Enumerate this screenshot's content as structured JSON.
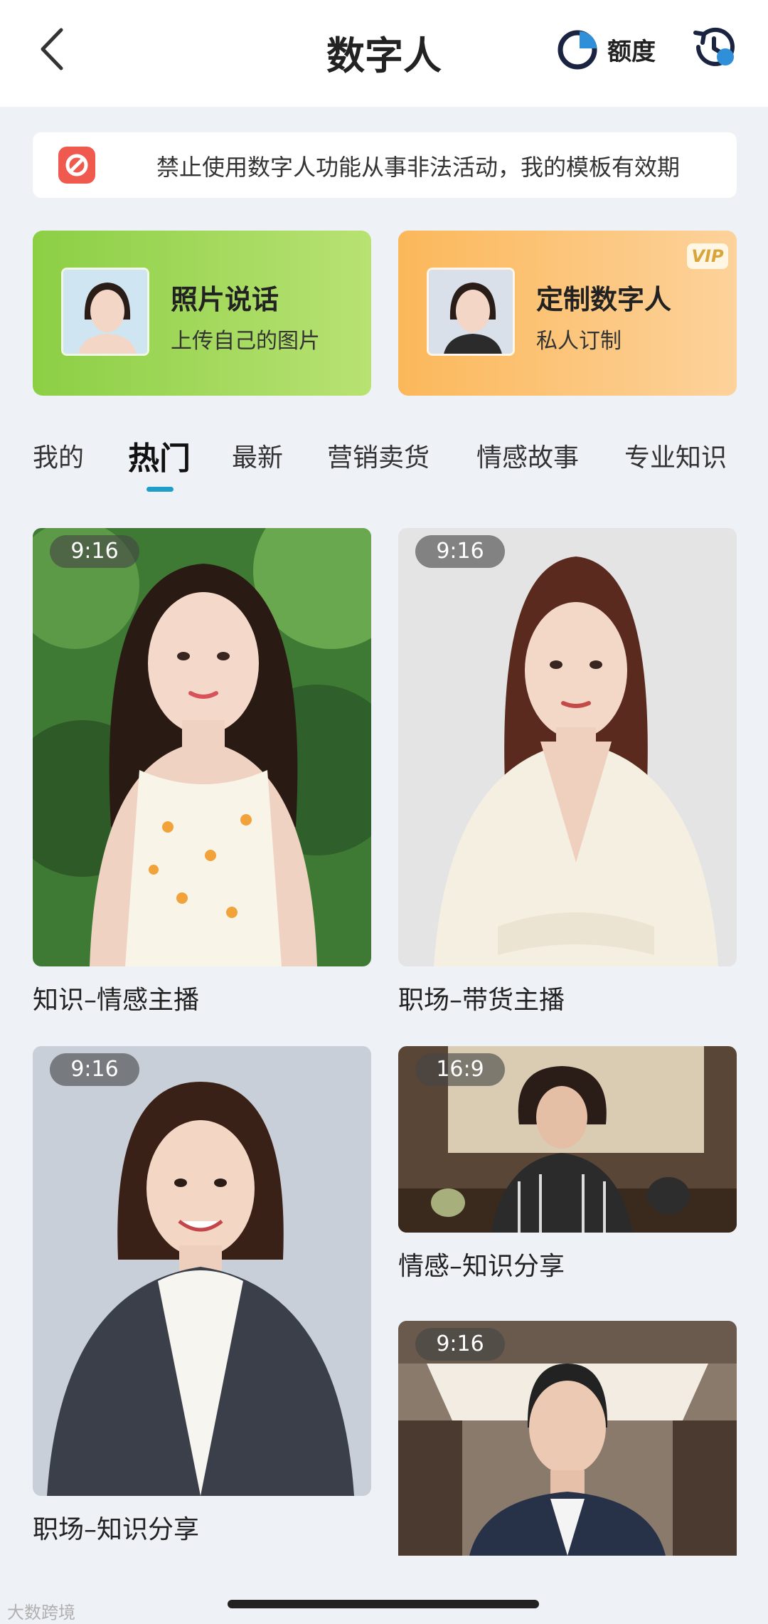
{
  "header": {
    "title": "数字人",
    "quota_label": "额度"
  },
  "notice": {
    "text": "禁止使用数字人功能从事非法活动，我的模板有效期"
  },
  "features": [
    {
      "title": "照片说话",
      "subtitle": "上传自己的图片",
      "accent": "#8ccf45"
    },
    {
      "title": "定制数字人",
      "subtitle": "私人订制",
      "badge": "VIP",
      "accent": "#fbb85a"
    }
  ],
  "tabs": [
    {
      "label": "我的"
    },
    {
      "label": "热门",
      "active": true
    },
    {
      "label": "最新"
    },
    {
      "label": "营销卖货"
    },
    {
      "label": "情感故事"
    },
    {
      "label": "专业知识"
    }
  ],
  "templates": [
    {
      "ratio": "9:16",
      "caption": "知识–情感主播"
    },
    {
      "ratio": "9:16",
      "caption": "职场–带货主播"
    },
    {
      "ratio": "9:16",
      "caption": "职场–知识分享"
    },
    {
      "ratio": "16:9",
      "caption": "情感–知识分享"
    },
    {
      "ratio": "9:16",
      "caption": ""
    }
  ],
  "watermark": "大数跨境",
  "colors": {
    "accent_underline": "#1e9ec8",
    "notice_icon": "#f05a4e",
    "background": "#eef2f6"
  }
}
